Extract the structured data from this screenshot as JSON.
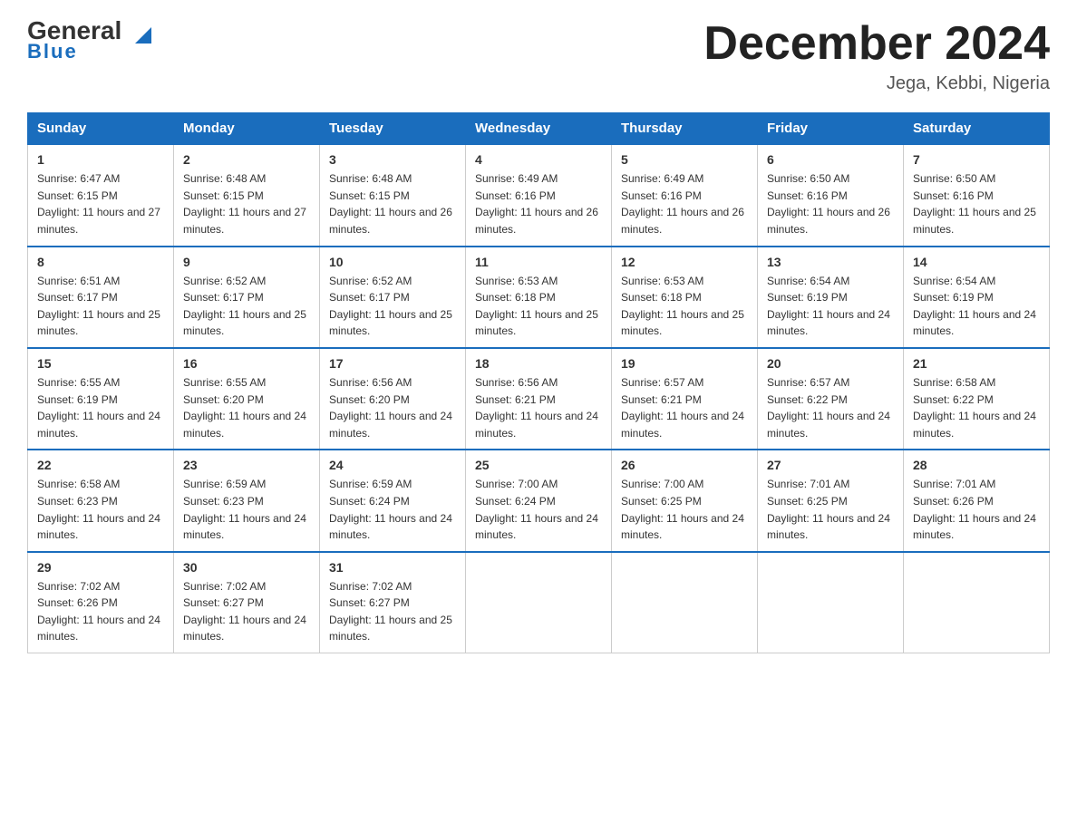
{
  "header": {
    "logo_text": "General",
    "logo_blue": "Blue",
    "month_title": "December 2024",
    "location": "Jega, Kebbi, Nigeria"
  },
  "days_of_week": [
    "Sunday",
    "Monday",
    "Tuesday",
    "Wednesday",
    "Thursday",
    "Friday",
    "Saturday"
  ],
  "weeks": [
    [
      {
        "day": "1",
        "sunrise": "6:47 AM",
        "sunset": "6:15 PM",
        "daylight": "11 hours and 27 minutes."
      },
      {
        "day": "2",
        "sunrise": "6:48 AM",
        "sunset": "6:15 PM",
        "daylight": "11 hours and 27 minutes."
      },
      {
        "day": "3",
        "sunrise": "6:48 AM",
        "sunset": "6:15 PM",
        "daylight": "11 hours and 26 minutes."
      },
      {
        "day": "4",
        "sunrise": "6:49 AM",
        "sunset": "6:16 PM",
        "daylight": "11 hours and 26 minutes."
      },
      {
        "day": "5",
        "sunrise": "6:49 AM",
        "sunset": "6:16 PM",
        "daylight": "11 hours and 26 minutes."
      },
      {
        "day": "6",
        "sunrise": "6:50 AM",
        "sunset": "6:16 PM",
        "daylight": "11 hours and 26 minutes."
      },
      {
        "day": "7",
        "sunrise": "6:50 AM",
        "sunset": "6:16 PM",
        "daylight": "11 hours and 25 minutes."
      }
    ],
    [
      {
        "day": "8",
        "sunrise": "6:51 AM",
        "sunset": "6:17 PM",
        "daylight": "11 hours and 25 minutes."
      },
      {
        "day": "9",
        "sunrise": "6:52 AM",
        "sunset": "6:17 PM",
        "daylight": "11 hours and 25 minutes."
      },
      {
        "day": "10",
        "sunrise": "6:52 AM",
        "sunset": "6:17 PM",
        "daylight": "11 hours and 25 minutes."
      },
      {
        "day": "11",
        "sunrise": "6:53 AM",
        "sunset": "6:18 PM",
        "daylight": "11 hours and 25 minutes."
      },
      {
        "day": "12",
        "sunrise": "6:53 AM",
        "sunset": "6:18 PM",
        "daylight": "11 hours and 25 minutes."
      },
      {
        "day": "13",
        "sunrise": "6:54 AM",
        "sunset": "6:19 PM",
        "daylight": "11 hours and 24 minutes."
      },
      {
        "day": "14",
        "sunrise": "6:54 AM",
        "sunset": "6:19 PM",
        "daylight": "11 hours and 24 minutes."
      }
    ],
    [
      {
        "day": "15",
        "sunrise": "6:55 AM",
        "sunset": "6:19 PM",
        "daylight": "11 hours and 24 minutes."
      },
      {
        "day": "16",
        "sunrise": "6:55 AM",
        "sunset": "6:20 PM",
        "daylight": "11 hours and 24 minutes."
      },
      {
        "day": "17",
        "sunrise": "6:56 AM",
        "sunset": "6:20 PM",
        "daylight": "11 hours and 24 minutes."
      },
      {
        "day": "18",
        "sunrise": "6:56 AM",
        "sunset": "6:21 PM",
        "daylight": "11 hours and 24 minutes."
      },
      {
        "day": "19",
        "sunrise": "6:57 AM",
        "sunset": "6:21 PM",
        "daylight": "11 hours and 24 minutes."
      },
      {
        "day": "20",
        "sunrise": "6:57 AM",
        "sunset": "6:22 PM",
        "daylight": "11 hours and 24 minutes."
      },
      {
        "day": "21",
        "sunrise": "6:58 AM",
        "sunset": "6:22 PM",
        "daylight": "11 hours and 24 minutes."
      }
    ],
    [
      {
        "day": "22",
        "sunrise": "6:58 AM",
        "sunset": "6:23 PM",
        "daylight": "11 hours and 24 minutes."
      },
      {
        "day": "23",
        "sunrise": "6:59 AM",
        "sunset": "6:23 PM",
        "daylight": "11 hours and 24 minutes."
      },
      {
        "day": "24",
        "sunrise": "6:59 AM",
        "sunset": "6:24 PM",
        "daylight": "11 hours and 24 minutes."
      },
      {
        "day": "25",
        "sunrise": "7:00 AM",
        "sunset": "6:24 PM",
        "daylight": "11 hours and 24 minutes."
      },
      {
        "day": "26",
        "sunrise": "7:00 AM",
        "sunset": "6:25 PM",
        "daylight": "11 hours and 24 minutes."
      },
      {
        "day": "27",
        "sunrise": "7:01 AM",
        "sunset": "6:25 PM",
        "daylight": "11 hours and 24 minutes."
      },
      {
        "day": "28",
        "sunrise": "7:01 AM",
        "sunset": "6:26 PM",
        "daylight": "11 hours and 24 minutes."
      }
    ],
    [
      {
        "day": "29",
        "sunrise": "7:02 AM",
        "sunset": "6:26 PM",
        "daylight": "11 hours and 24 minutes."
      },
      {
        "day": "30",
        "sunrise": "7:02 AM",
        "sunset": "6:27 PM",
        "daylight": "11 hours and 24 minutes."
      },
      {
        "day": "31",
        "sunrise": "7:02 AM",
        "sunset": "6:27 PM",
        "daylight": "11 hours and 25 minutes."
      },
      null,
      null,
      null,
      null
    ]
  ]
}
